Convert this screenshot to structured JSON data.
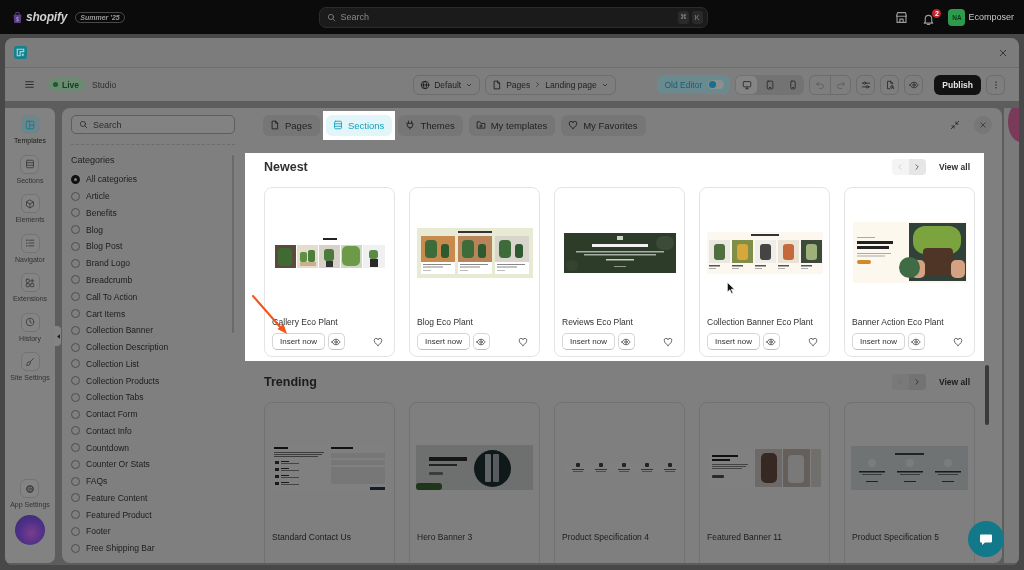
{
  "top_bar": {
    "brand": "shopify",
    "edition": "Summer '25",
    "search": {
      "placeholder": "Search",
      "keys": [
        "⌘",
        "K"
      ]
    },
    "notifications": "2",
    "user": {
      "initials": "NA",
      "name": "Ecomposer"
    }
  },
  "toolbar": {
    "status": "Live",
    "workspace": "Studio",
    "language": "Default",
    "breadcrumb": [
      "Pages",
      "Landing page"
    ],
    "old_editor": {
      "label": "Old Editor",
      "on": false
    },
    "devices": [
      {
        "kind": "desktop",
        "selected": true
      },
      {
        "kind": "tablet",
        "selected": false
      },
      {
        "kind": "mobile",
        "selected": false
      }
    ],
    "history": [
      {
        "kind": "undo",
        "disabled": true
      },
      {
        "kind": "redo",
        "disabled": true
      }
    ],
    "publish": "Publish"
  },
  "sidebar": {
    "items": [
      {
        "label": "Templates",
        "selected": true
      },
      {
        "label": "Sections",
        "selected": false
      },
      {
        "label": "Elements",
        "selected": false
      },
      {
        "label": "Navigator",
        "selected": false
      },
      {
        "label": "Extensions",
        "selected": false
      },
      {
        "label": "History",
        "selected": false
      },
      {
        "label": "Site Settings",
        "selected": false
      }
    ],
    "footer": {
      "label": "App Settings"
    }
  },
  "library": {
    "categories": {
      "search": {
        "placeholder": "Search"
      },
      "title": "Categories",
      "items": [
        {
          "label": "All categories",
          "selected": true
        },
        {
          "label": "Article",
          "selected": false
        },
        {
          "label": "Benefits",
          "selected": false
        },
        {
          "label": "Blog",
          "selected": false
        },
        {
          "label": "Blog Post",
          "selected": false
        },
        {
          "label": "Brand Logo",
          "selected": false
        },
        {
          "label": "Breadcrumb",
          "selected": false
        },
        {
          "label": "Call To Action",
          "selected": false
        },
        {
          "label": "Cart Items",
          "selected": false
        },
        {
          "label": "Collection Banner",
          "selected": false
        },
        {
          "label": "Collection Description",
          "selected": false
        },
        {
          "label": "Collection List",
          "selected": false
        },
        {
          "label": "Collection Products",
          "selected": false
        },
        {
          "label": "Collection Tabs",
          "selected": false
        },
        {
          "label": "Contact Form",
          "selected": false
        },
        {
          "label": "Contact Info",
          "selected": false
        },
        {
          "label": "Countdown",
          "selected": false
        },
        {
          "label": "Counter Or Stats",
          "selected": false
        },
        {
          "label": "FAQs",
          "selected": false
        },
        {
          "label": "Feature Content",
          "selected": false
        },
        {
          "label": "Featured Product",
          "selected": false
        },
        {
          "label": "Footer",
          "selected": false
        },
        {
          "label": "Free Shipping Bar",
          "selected": false
        }
      ]
    },
    "tabs": [
      {
        "label": "Pages",
        "selected": false,
        "highlighted": false
      },
      {
        "label": "Sections",
        "selected": true,
        "highlighted": true
      },
      {
        "label": "Themes",
        "selected": false,
        "highlighted": false
      },
      {
        "label": "My templates",
        "selected": false,
        "highlighted": false
      },
      {
        "label": "My Favorites",
        "selected": false,
        "highlighted": false
      }
    ],
    "sections": [
      {
        "title": "Newest",
        "highlighted": true,
        "pager": [
          {
            "kind": "prev",
            "disabled": true
          },
          {
            "kind": "next",
            "disabled": false
          }
        ],
        "view_all": "View all",
        "cards": [
          {
            "title": "Gallery Eco Plant",
            "button": "Insert now",
            "favorite": false
          },
          {
            "title": "Blog Eco Plant",
            "button": "Insert now",
            "favorite": false
          },
          {
            "title": "Reviews Eco Plant",
            "button": "Insert now",
            "favorite": false
          },
          {
            "title": "Collection Banner Eco Plant",
            "button": "Insert now",
            "favorite": false
          },
          {
            "title": "Banner Action Eco Plant",
            "button": "Insert now",
            "favorite": false
          }
        ]
      },
      {
        "title": "Trending",
        "highlighted": false,
        "pager": [
          {
            "kind": "prev",
            "disabled": true
          },
          {
            "kind": "next",
            "disabled": false
          }
        ],
        "view_all": "View all",
        "cards": [
          {
            "title": "Standard Contact Us"
          },
          {
            "title": "Hero Banner 3"
          },
          {
            "title": "Product Specification 4"
          },
          {
            "title": "Featured Banner 11"
          },
          {
            "title": "Product Specification 5"
          }
        ]
      }
    ]
  }
}
